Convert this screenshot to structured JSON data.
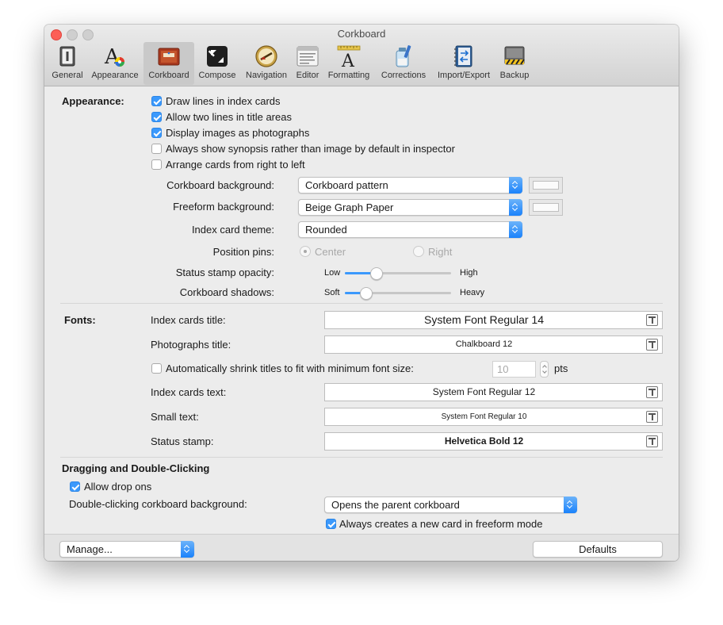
{
  "window": {
    "title": "Corkboard"
  },
  "toolbar": [
    {
      "label": "General",
      "icon": "general-icon"
    },
    {
      "label": "Appearance",
      "icon": "appearance-icon"
    },
    {
      "label": "Corkboard",
      "icon": "corkboard-icon"
    },
    {
      "label": "Compose",
      "icon": "compose-icon"
    },
    {
      "label": "Navigation",
      "icon": "navigation-icon"
    },
    {
      "label": "Editor",
      "icon": "editor-icon"
    },
    {
      "label": "Formatting",
      "icon": "formatting-icon"
    },
    {
      "label": "Corrections",
      "icon": "corrections-icon"
    },
    {
      "label": "Import/Export",
      "icon": "import-export-icon"
    },
    {
      "label": "Backup",
      "icon": "backup-icon"
    }
  ],
  "appearance": {
    "title": "Appearance:",
    "checkboxes": [
      {
        "label": "Draw lines in index cards",
        "checked": true
      },
      {
        "label": "Allow two lines in title areas",
        "checked": true
      },
      {
        "label": "Display images as photographs",
        "checked": true
      },
      {
        "label": "Always show synopsis rather than image by default in inspector",
        "checked": false
      },
      {
        "label": "Arrange cards from right to left",
        "checked": false
      }
    ],
    "corkboard_background": {
      "label": "Corkboard background:",
      "value": "Corkboard pattern"
    },
    "freeform_background": {
      "label": "Freeform background:",
      "value": "Beige Graph Paper"
    },
    "index_card_theme": {
      "label": "Index card theme:",
      "value": "Rounded"
    },
    "position_pins": {
      "label": "Position pins:",
      "options": [
        "Center",
        "Right"
      ],
      "selected": "Center"
    },
    "status_stamp_opacity": {
      "label": "Status stamp opacity:",
      "min_label": "Low",
      "max_label": "High",
      "value": 0.3
    },
    "corkboard_shadows": {
      "label": "Corkboard shadows:",
      "min_label": "Soft",
      "max_label": "Heavy",
      "value": 0.2
    }
  },
  "fonts": {
    "title": "Fonts:",
    "index_cards_title": {
      "label": "Index cards title:",
      "value": "System Font Regular 14"
    },
    "photographs_title": {
      "label": "Photographs title:",
      "value": "Chalkboard 12"
    },
    "auto_shrink": {
      "label": "Automatically shrink titles to fit with minimum font size:",
      "checked": false,
      "value": "10",
      "unit": "pts"
    },
    "index_cards_text": {
      "label": "Index cards text:",
      "value": "System Font Regular 12"
    },
    "small_text": {
      "label": "Small text:",
      "value": "System Font Regular 10"
    },
    "status_stamp": {
      "label": "Status stamp:",
      "value": "Helvetica Bold 12"
    }
  },
  "dragging": {
    "title": "Dragging and Double-Clicking",
    "allow_drop_ons": {
      "label": "Allow drop ons",
      "checked": true
    },
    "double_click": {
      "label": "Double-clicking corkboard background:",
      "value": "Opens the parent corkboard"
    },
    "always_new_card": {
      "label": "Always creates a new card in freeform mode",
      "checked": true
    }
  },
  "bottom": {
    "manage_label": "Manage...",
    "defaults_label": "Defaults"
  },
  "colors": {
    "accent": "#3b99fc",
    "selected_tab": "#c9c9c9",
    "close_button": "#fc5f57"
  }
}
